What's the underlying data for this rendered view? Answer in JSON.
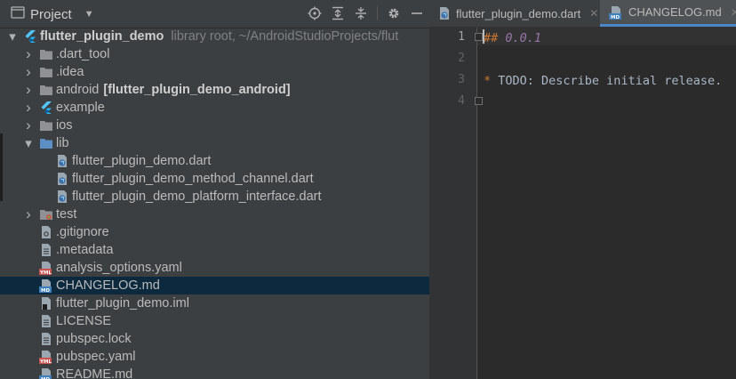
{
  "project_panel": {
    "title": "Project",
    "tree": [
      {
        "indent": 0,
        "arrow": "down",
        "icon": "flutter-icon",
        "name": "flutter_plugin_demo",
        "bold": true,
        "hint": "library root,  ~/AndroidStudioProjects/flut"
      },
      {
        "indent": 1,
        "arrow": "right",
        "icon": "folder-icon",
        "name": ".dart_tool"
      },
      {
        "indent": 1,
        "arrow": "right",
        "icon": "folder-icon",
        "name": ".idea"
      },
      {
        "indent": 1,
        "arrow": "right",
        "icon": "folder-icon",
        "name": "android",
        "module": "[flutter_plugin_demo_android]"
      },
      {
        "indent": 1,
        "arrow": "right",
        "icon": "flutter-icon",
        "name": "example"
      },
      {
        "indent": 1,
        "arrow": "right",
        "icon": "folder-icon",
        "name": "ios"
      },
      {
        "indent": 1,
        "arrow": "down",
        "icon": "folder-blue-icon",
        "name": "lib"
      },
      {
        "indent": 2,
        "arrow": "",
        "icon": "dart-file-icon",
        "name": "flutter_plugin_demo.dart"
      },
      {
        "indent": 2,
        "arrow": "",
        "icon": "dart-file-icon",
        "name": "flutter_plugin_demo_method_channel.dart"
      },
      {
        "indent": 2,
        "arrow": "",
        "icon": "dart-file-icon",
        "name": "flutter_plugin_demo_platform_interface.dart"
      },
      {
        "indent": 1,
        "arrow": "right",
        "icon": "folder-test-icon",
        "name": "test"
      },
      {
        "indent": 1,
        "arrow": "",
        "icon": "gitignore-file-icon",
        "name": ".gitignore"
      },
      {
        "indent": 1,
        "arrow": "",
        "icon": "text-file-icon",
        "name": ".metadata"
      },
      {
        "indent": 1,
        "arrow": "",
        "icon": "yaml-file-icon",
        "name": "analysis_options.yaml"
      },
      {
        "indent": 1,
        "arrow": "",
        "icon": "markdown-file-icon",
        "name": "CHANGELOG.md",
        "selected": true
      },
      {
        "indent": 1,
        "arrow": "",
        "icon": "iml-file-icon",
        "name": "flutter_plugin_demo.iml"
      },
      {
        "indent": 1,
        "arrow": "",
        "icon": "text-file-icon",
        "name": "LICENSE"
      },
      {
        "indent": 1,
        "arrow": "",
        "icon": "text-file-icon",
        "name": "pubspec.lock"
      },
      {
        "indent": 1,
        "arrow": "",
        "icon": "yaml-file-icon",
        "name": "pubspec.yaml"
      },
      {
        "indent": 1,
        "arrow": "",
        "icon": "markdown-file-icon",
        "name": "README.md"
      }
    ]
  },
  "editor": {
    "tabs": [
      {
        "label": "flutter_plugin_demo.dart",
        "icon": "dart-file-icon",
        "active": false
      },
      {
        "label": "CHANGELOG.md",
        "icon": "markdown-file-icon",
        "active": true
      }
    ],
    "lines": [
      {
        "number": "1",
        "hash": "##",
        "text": " 0.0.1",
        "kind": "heading"
      },
      {
        "number": "2",
        "text": "",
        "kind": "empty"
      },
      {
        "number": "3",
        "bullet": "*",
        "text": " TODO: Describe initial release.",
        "kind": "bullet"
      },
      {
        "number": "4",
        "text": "",
        "kind": "empty"
      }
    ]
  },
  "colors": {
    "panel_bg": "#3c3f41",
    "editor_bg": "#2b2b2b",
    "selection": "#0d293e",
    "accent": "#4a88c7"
  }
}
